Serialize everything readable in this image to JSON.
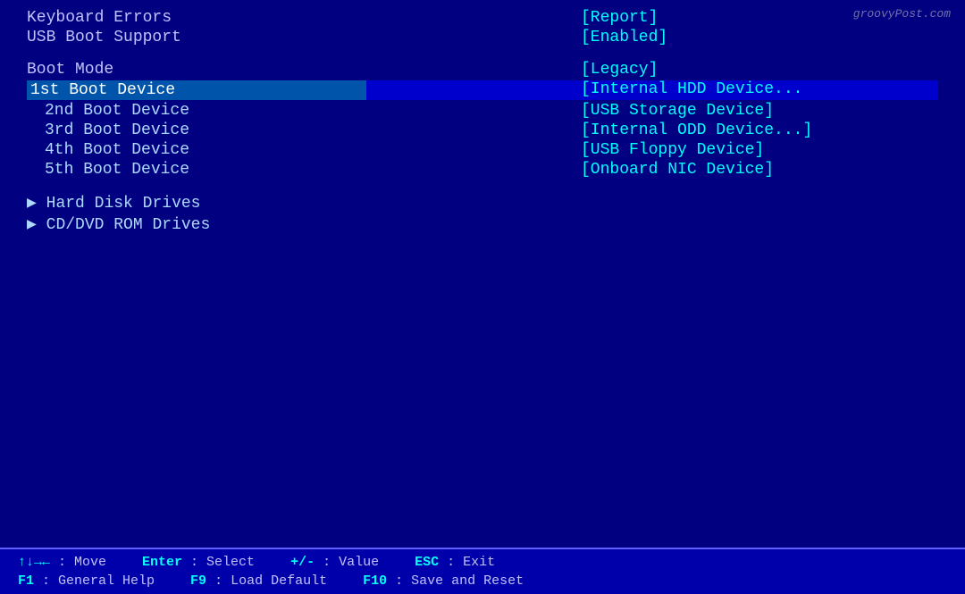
{
  "watermark": "groovyPost.com",
  "rows": [
    {
      "id": "keyboard-errors",
      "left": "Keyboard Errors",
      "right": "[Report]",
      "type": "normal"
    },
    {
      "id": "usb-boot-support",
      "left": "USB Boot Support",
      "right": "[Enabled]",
      "type": "normal"
    },
    {
      "id": "gap1",
      "type": "gap"
    },
    {
      "id": "boot-mode",
      "left": "Boot Mode",
      "right": "[Legacy]",
      "type": "normal"
    },
    {
      "id": "boot-1",
      "left": "1st Boot Device",
      "right": "[Internal HDD Device...",
      "type": "highlighted"
    },
    {
      "id": "boot-2",
      "left": "2nd Boot Device",
      "right": "[USB Storage Device]",
      "type": "sub"
    },
    {
      "id": "boot-3",
      "left": "3rd Boot Device",
      "right": "[Internal ODD Device...]",
      "type": "sub"
    },
    {
      "id": "boot-4",
      "left": "4th Boot Device",
      "right": "[USB Floppy Device]",
      "type": "sub"
    },
    {
      "id": "boot-5",
      "left": "5th Boot Device",
      "right": "[Onboard NIC Device]",
      "type": "sub"
    },
    {
      "id": "gap2",
      "type": "gap"
    },
    {
      "id": "hard-disk",
      "left": "Hard Disk Drives",
      "right": "",
      "type": "arrow"
    },
    {
      "id": "cdvd-rom",
      "left": "CD/DVD ROM Drives",
      "right": "",
      "type": "arrow"
    }
  ],
  "footer": {
    "row1": [
      {
        "key": "↑↓→←",
        "desc": " : Move"
      },
      {
        "key": "Enter",
        "desc": " : Select"
      },
      {
        "key": "+/-",
        "desc": " : Value"
      },
      {
        "key": "ESC",
        "desc": " : Exit"
      }
    ],
    "row2": [
      {
        "key": "F1",
        "desc": " : General Help"
      },
      {
        "key": "F9",
        "desc": " : Load Default"
      },
      {
        "key": "F10",
        "desc": " : Save and Reset"
      }
    ]
  }
}
